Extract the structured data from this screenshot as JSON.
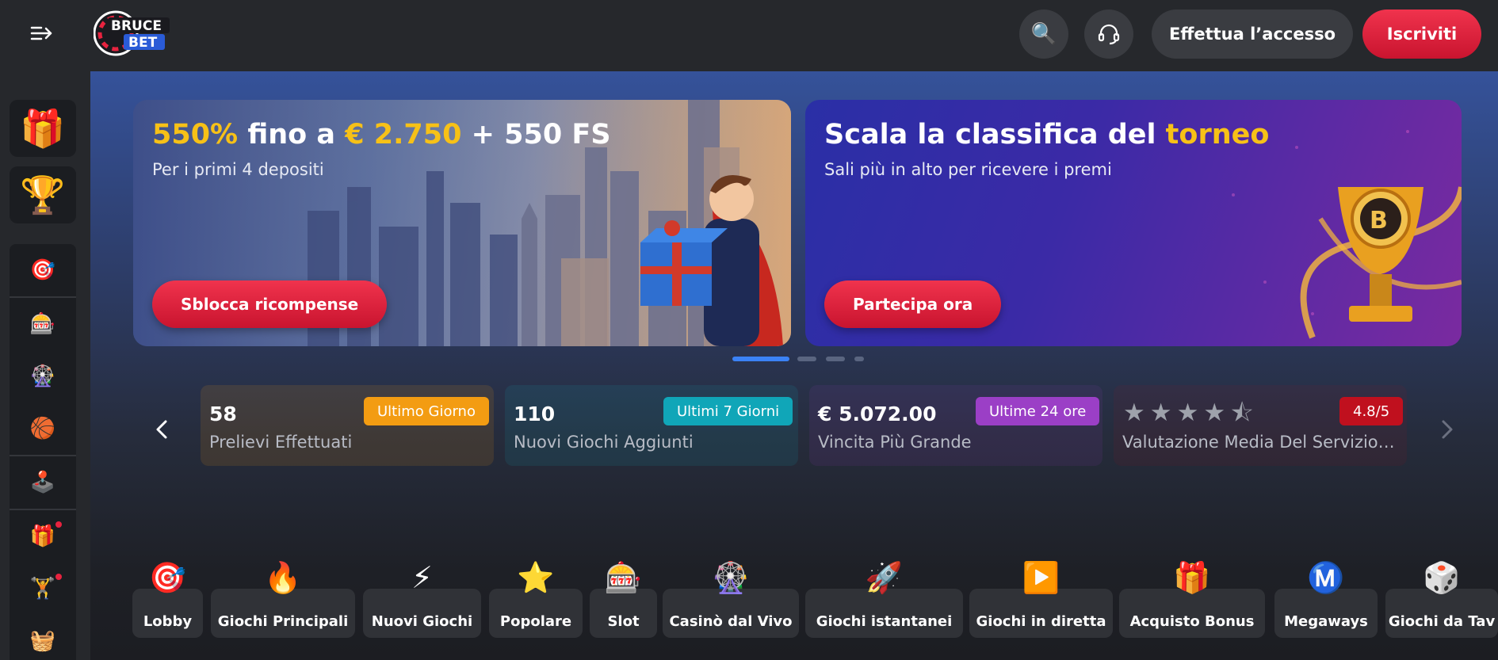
{
  "header": {
    "brand_line1": "BRUCE",
    "brand_line2": "BET",
    "login_label": "Effettua l’accesso",
    "register_label": "Iscriviti",
    "icons": [
      "menu-arrow-icon",
      "search-icon",
      "headset-icon"
    ]
  },
  "sidebar": {
    "promo_icons": [
      "gift-icon",
      "trophy-icon"
    ],
    "items": [
      {
        "name": "target-icon",
        "glyph": "🎯"
      },
      {
        "name": "slot-machine-icon",
        "glyph": "🎰"
      },
      {
        "name": "roulette-icon",
        "glyph": "🎡"
      },
      {
        "name": "basketball-icon",
        "glyph": "🏀"
      },
      {
        "name": "joystick-icon",
        "glyph": "🕹️"
      },
      {
        "name": "gift-icon",
        "glyph": "🎁"
      },
      {
        "name": "bonus-icon",
        "glyph": "🏋️"
      },
      {
        "name": "basket-icon",
        "glyph": "🧺"
      }
    ]
  },
  "banners": [
    {
      "title_parts": [
        "550%",
        " fino a ",
        "€ 2.750",
        " + 550 FS"
      ],
      "subtitle": "Per i primi 4 depositi",
      "cta": "Sblocca ricompense"
    },
    {
      "title_parts": [
        "Scala la classifica del ",
        "torneo"
      ],
      "subtitle": "Sali più in alto per ricevere i premi",
      "cta": "Partecipa ora"
    }
  ],
  "stats": [
    {
      "value": "58",
      "label": "Prelievi Effettuati",
      "badge": "Ultimo Giorno",
      "badge_color": "#f39c12",
      "card_tint": "rgba(243,156,18,0.12)"
    },
    {
      "value": "110",
      "label": "Nuovi Giochi Aggiunti",
      "badge": "Ultimi 7 Giorni",
      "badge_color": "#10a6b8",
      "card_tint": "rgba(16,166,184,0.12)"
    },
    {
      "value": "€ 5.072.00",
      "label": "Vincita Più Grande",
      "badge": "Ultime 24 ore",
      "badge_color": "#9b3fc6",
      "card_tint": "rgba(155,63,198,0.10)"
    },
    {
      "value": "",
      "label": "Valutazione Media Del Servizio Cli...",
      "badge": "4.8/5",
      "badge_color": "#c0101e",
      "card_tint": "rgba(192,16,30,0.08)",
      "rating": 4.5
    }
  ],
  "categories": [
    {
      "label": "Lobby",
      "icon": "target-icon",
      "glyph": "🎯"
    },
    {
      "label": "Giochi Principali",
      "icon": "fire-icon",
      "glyph": "🔥"
    },
    {
      "label": "Nuovi Giochi",
      "icon": "lightning-icon",
      "glyph": "⚡"
    },
    {
      "label": "Popolare",
      "icon": "star-icon",
      "glyph": "⭐"
    },
    {
      "label": "Slot",
      "icon": "slot-machine-icon",
      "glyph": "🎰"
    },
    {
      "label": "Casinò dal Vivo",
      "icon": "roulette-icon",
      "glyph": "🎡"
    },
    {
      "label": "Giochi istantanei",
      "icon": "rocket-icon",
      "glyph": "🚀"
    },
    {
      "label": "Giochi in diretta",
      "icon": "play-icon",
      "glyph": "▶️"
    },
    {
      "label": "Acquisto Bonus",
      "icon": "gift-icon",
      "glyph": "🎁"
    },
    {
      "label": "Megaways",
      "icon": "megaways-icon",
      "glyph": "Ⓜ️"
    },
    {
      "label": "Giochi da Tav",
      "icon": "dice-icon",
      "glyph": "🎲"
    }
  ],
  "colors": {
    "accent_red": "#e8233f",
    "highlight_yellow": "#f7c117",
    "header_bg": "#26282c"
  }
}
